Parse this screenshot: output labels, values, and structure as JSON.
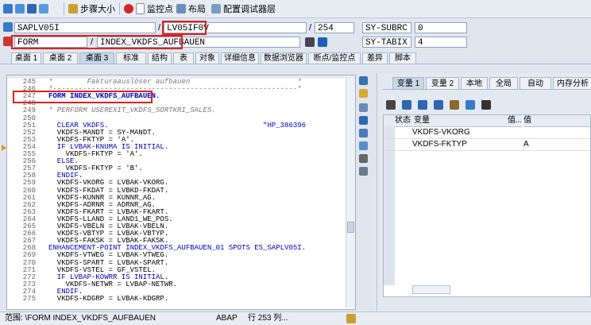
{
  "toolbar": {
    "step_size": "步骤大小",
    "watchpoint": "监控点",
    "layout": "布局",
    "config_debugger_layer": "配置调试器层"
  },
  "fields": {
    "program": "SAPLV05I",
    "include": "LV05IF0V",
    "line": "254",
    "sy_subrc_label": "SY-SUBRC",
    "sy_subrc_value": "0",
    "event_type": "FORM",
    "event_name": "INDEX_VKDFS_AUFBAUEN",
    "sy_tabix_label": "SY-TABIX",
    "sy_tabix_value": "4"
  },
  "main_tabs": [
    "桌面 1",
    "桌面 2",
    "桌面 3",
    "标准",
    "结构",
    "表",
    "对象",
    "详细信息",
    "数据浏览器",
    "断点/监控点",
    "差异",
    "脚本"
  ],
  "code": {
    "line_numbers": [
      "245",
      "246",
      "247",
      "248",
      "249",
      "250",
      "251",
      "252",
      "253",
      "254",
      "255",
      "256",
      "257",
      "258",
      "259",
      "260",
      "261",
      "262",
      "263",
      "264",
      "265",
      "266",
      "267",
      "268",
      "269",
      "270",
      "271",
      "272",
      "273",
      "274",
      "275"
    ],
    "lines": [
      "*        Fakturaauslöser aufbauen                         *",
      "*---------------------------------------------------------*",
      "FORM INDEX_VKDFS_AUFBAUEN.",
      "",
      "* PERFORM USEREXIT_VKDFS_SORTKRI_SALES.",
      "",
      "  CLEAR VKDFS.                                    \"HP_386396",
      "  VKDFS-MANDT = SY-MANDT.",
      "  VKDFS-FKTYP = 'A'.",
      "  IF LVBAK-KNUMA IS INITIAL.",
      "    VKDFS-FKTYP = 'A'.",
      "  ELSE.",
      "    VKDFS-FKTYP = 'B'.",
      "  ENDIF.",
      "  VKDFS-VKORG = LVBAK-VKORG.",
      "  VKDFS-FKDAT = LVBKD-FKDAT.",
      "  VKDFS-KUNNR = KUNNR_AG.",
      "  VKDFS-ADRNR = ADRNR_AG.",
      "  VKDFS-FKART = LVBAK-FKART.",
      "  VKDFS-LLAND = LAND1_WE_POS.",
      "  VKDFS-VBELN = LVBAK-VBELN.",
      "  VKDFS-VBTYP = LVBAK-VBTYP.",
      "  VKDFS-FAKSK = LVBAK-FAKSK.",
      "ENHANCEMENT-POINT INDEX_VKDFS_AUFBAUEN_01 SPOTS ES_SAPLV05I.",
      "  VKDFS-VTWEG = LVBAK-VTWEG.",
      "  VKDFS-SPART = LVBAK-SPART.",
      "  VKDFS-VSTEL = GF_VSTEL.",
      "  IF LVBAP-KOWRR IS INITIAL.",
      "    VKDFS-NETWR = LVBAP-NETWR.",
      "  ENDIF.",
      "  VKDFS-KDGRP = LVBAK-KDGRP."
    ],
    "current_line_index": 9
  },
  "var_tabs": [
    "变量 1",
    "变量 2",
    "本地",
    "全局",
    "自动",
    "内存分析"
  ],
  "grid": {
    "headers": [
      "状态",
      "变量",
      "值...",
      "值"
    ],
    "rows": [
      {
        "variable": "VKDFS-VKORG",
        "value": ""
      },
      {
        "variable": "VKDFS-FKTYP",
        "value": "A"
      }
    ]
  },
  "status": {
    "scope": "范围: \\FORM INDEX_VKDFS_AUFBAUEN",
    "lang": "ABAP",
    "position": "行 253 列..."
  },
  "colors": {
    "highlight_red": "#e02020",
    "keyword_blue": "#0000c0",
    "panel_bg": "#dfe6ef"
  }
}
